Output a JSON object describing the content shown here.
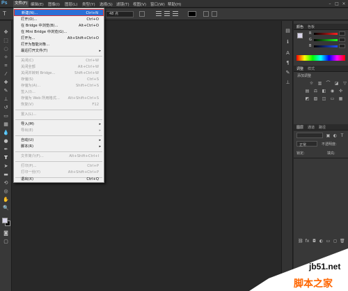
{
  "app": {
    "logo": "Ps"
  },
  "menubar": {
    "items": [
      "文件(F)",
      "编辑(E)",
      "图像(I)",
      "图层(L)",
      "类型(Y)",
      "选择(S)",
      "滤镜(T)",
      "视图(V)",
      "窗口(W)",
      "帮助(H)"
    ],
    "window_buttons": [
      "–",
      "□",
      "×"
    ]
  },
  "options_bar": {
    "tool_icon": "T",
    "font_size": "48 点"
  },
  "file_menu": {
    "items": [
      {
        "label": "新建(N)...",
        "shortcut": "Ctrl+N",
        "state": "highlighted"
      },
      {
        "label": "打开(O)...",
        "shortcut": "Ctrl+O",
        "state": "enabled"
      },
      {
        "label": "在 Bridge 中浏览(B)...",
        "shortcut": "Alt+Ctrl+O",
        "state": "enabled"
      },
      {
        "label": "在 Mini Bridge 中浏览(G)...",
        "shortcut": "",
        "state": "enabled"
      },
      {
        "label": "打开为...",
        "shortcut": "Alt+Shift+Ctrl+O",
        "state": "enabled"
      },
      {
        "label": "打开为智能对象...",
        "shortcut": "",
        "state": "enabled"
      },
      {
        "label": "最近打开文件(T)",
        "shortcut": "",
        "state": "submenu"
      },
      {
        "label": "关闭(C)",
        "shortcut": "Ctrl+W",
        "state": "disabled"
      },
      {
        "label": "关闭全部",
        "shortcut": "Alt+Ctrl+W",
        "state": "disabled"
      },
      {
        "label": "关闭并转到 Bridge...",
        "shortcut": "Shift+Ctrl+W",
        "state": "disabled"
      },
      {
        "label": "存储(S)",
        "shortcut": "Ctrl+S",
        "state": "disabled"
      },
      {
        "label": "存储为(A)...",
        "shortcut": "Shift+Ctrl+S",
        "state": "disabled"
      },
      {
        "label": "签入(I)...",
        "shortcut": "",
        "state": "disabled"
      },
      {
        "label": "存储为 Web 所用格式...",
        "shortcut": "Alt+Shift+Ctrl+S",
        "state": "disabled"
      },
      {
        "label": "恢复(V)",
        "shortcut": "F12",
        "state": "disabled"
      },
      {
        "label": "置入(L)...",
        "shortcut": "",
        "state": "disabled"
      },
      {
        "label": "导入(M)",
        "shortcut": "",
        "state": "submenu"
      },
      {
        "label": "导出(E)",
        "shortcut": "",
        "state": "submenu-disabled"
      },
      {
        "label": "自动(U)",
        "shortcut": "",
        "state": "submenu"
      },
      {
        "label": "脚本(R)",
        "shortcut": "",
        "state": "submenu"
      },
      {
        "label": "文件简介(F)...",
        "shortcut": "Alt+Shift+Ctrl+I",
        "state": "disabled"
      },
      {
        "label": "打印(P)...",
        "shortcut": "Ctrl+P",
        "state": "disabled"
      },
      {
        "label": "打印一份(Y)",
        "shortcut": "Alt+Shift+Ctrl+P",
        "state": "disabled"
      },
      {
        "label": "退出(X)",
        "shortcut": "Ctrl+Q",
        "state": "enabled"
      }
    ],
    "submenu_arrow": "▸"
  },
  "right_panel": {
    "color_tabs": [
      "颜色",
      "色板"
    ],
    "channels": [
      {
        "label": "R",
        "value": ""
      },
      {
        "label": "G",
        "value": ""
      },
      {
        "label": "B",
        "value": ""
      }
    ],
    "adjust_tabs": [
      "调整",
      "样式"
    ],
    "adjust_title": "添加调整",
    "layers_tabs": [
      "图层",
      "通道",
      "路径"
    ],
    "blend_mode": "正常",
    "opacity_label": "不透明度:",
    "lock_label": "锁定:",
    "fill_label": "填充:"
  },
  "colors": {
    "menu_highlight": "#2b6fd6",
    "highlight_border": "#e03030",
    "ui_dark": "#282828"
  },
  "watermark": {
    "site": "jb51.net",
    "brand": "脚本之家"
  }
}
